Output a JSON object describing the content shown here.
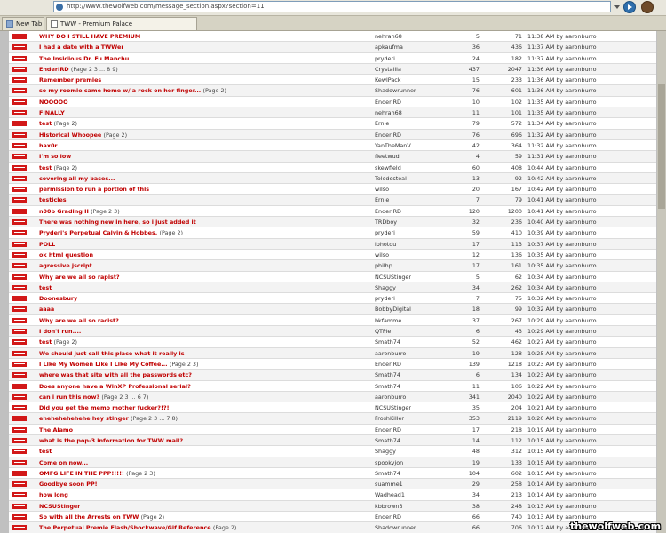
{
  "browser": {
    "url": "http://www.thewolfweb.com/message_section.aspx?section=11",
    "tabs": [
      {
        "label": "New Tab"
      },
      {
        "label": "TWW - Premium Palace"
      }
    ]
  },
  "watermark": "thewolfweb.com",
  "threads": [
    {
      "title": "WHY DO I STILL HAVE PREMIUM",
      "pages": "",
      "author": "nehrah68",
      "replies": "5",
      "views": "71",
      "last": "11:38 AM by aaronburro"
    },
    {
      "title": "I had a date with a TWWer",
      "pages": "",
      "author": "apkaufma",
      "replies": "36",
      "views": "436",
      "last": "11:37 AM by aaronburro"
    },
    {
      "title": "The Insidious Dr. Fu Manchu",
      "pages": "",
      "author": "pryderi",
      "replies": "24",
      "views": "182",
      "last": "11:37 AM by aaronburro"
    },
    {
      "title": "EnderIRD",
      "pages": "(Page 2 3 ... 8 9)",
      "author": "Crystallia",
      "replies": "437",
      "views": "2047",
      "last": "11:36 AM by aaronburro"
    },
    {
      "title": "Remember premies",
      "pages": "",
      "author": "KewlPack",
      "replies": "15",
      "views": "233",
      "last": "11:36 AM by aaronburro"
    },
    {
      "title": "so my roomie came home w/ a rock on her finger...",
      "pages": "(Page 2)",
      "author": "Shadowrunner",
      "replies": "76",
      "views": "601",
      "last": "11:36 AM by aaronburro"
    },
    {
      "title": "NOOOOO",
      "pages": "",
      "author": "EnderIRD",
      "replies": "10",
      "views": "102",
      "last": "11:35 AM by aaronburro"
    },
    {
      "title": "FINALLY",
      "pages": "",
      "author": "nehrah68",
      "replies": "11",
      "views": "101",
      "last": "11:35 AM by aaronburro"
    },
    {
      "title": "test",
      "pages": "(Page 2)",
      "author": "Ernie",
      "replies": "79",
      "views": "572",
      "last": "11:34 AM by aaronburro"
    },
    {
      "title": "Historical Whoopee",
      "pages": "(Page 2)",
      "author": "EnderIRD",
      "replies": "76",
      "views": "696",
      "last": "11:32 AM by aaronburro"
    },
    {
      "title": "hax0r",
      "pages": "",
      "author": "YanTheManV",
      "replies": "42",
      "views": "364",
      "last": "11:32 AM by aaronburro"
    },
    {
      "title": "I'm so low",
      "pages": "",
      "author": "fleetwud",
      "replies": "4",
      "views": "59",
      "last": "11:31 AM by aaronburro"
    },
    {
      "title": "test",
      "pages": "(Page 2)",
      "author": "skewfield",
      "replies": "60",
      "views": "408",
      "last": "10:44 AM by aaronburro"
    },
    {
      "title": "covering all my bases...",
      "pages": "",
      "author": "Toledosteal",
      "replies": "13",
      "views": "92",
      "last": "10:42 AM by aaronburro"
    },
    {
      "title": "permission to run a portion of this",
      "pages": "",
      "author": "wilso",
      "replies": "20",
      "views": "167",
      "last": "10:42 AM by aaronburro"
    },
    {
      "title": "testicles",
      "pages": "",
      "author": "Ernie",
      "replies": "7",
      "views": "79",
      "last": "10:41 AM by aaronburro"
    },
    {
      "title": "n00b Grading II",
      "pages": "(Page 2 3)",
      "author": "EnderIRD",
      "replies": "120",
      "views": "1200",
      "last": "10:41 AM by aaronburro"
    },
    {
      "title": "There was nothing new in here, so i just added it",
      "pages": "",
      "author": "TRDboy",
      "replies": "32",
      "views": "236",
      "last": "10:40 AM by aaronburro"
    },
    {
      "title": "Pryderi's Perpetual Calvin & Hobbes.",
      "pages": "(Page 2)",
      "author": "pryderi",
      "replies": "59",
      "views": "410",
      "last": "10:39 AM by aaronburro"
    },
    {
      "title": "POLL",
      "pages": "",
      "author": "iphotou",
      "replies": "17",
      "views": "113",
      "last": "10:37 AM by aaronburro"
    },
    {
      "title": "ok html question",
      "pages": "",
      "author": "wilso",
      "replies": "12",
      "views": "136",
      "last": "10:35 AM by aaronburro"
    },
    {
      "title": "agressive jscript",
      "pages": "",
      "author": "philhp",
      "replies": "17",
      "views": "161",
      "last": "10:35 AM by aaronburro"
    },
    {
      "title": "Why are we all so rapist?",
      "pages": "",
      "author": "NCSUStinger",
      "replies": "5",
      "views": "62",
      "last": "10:34 AM by aaronburro"
    },
    {
      "title": "test",
      "pages": "",
      "author": "Shaggy",
      "replies": "34",
      "views": "262",
      "last": "10:34 AM by aaronburro"
    },
    {
      "title": "Doonesbury",
      "pages": "",
      "author": "pryderi",
      "replies": "7",
      "views": "75",
      "last": "10:32 AM by aaronburro"
    },
    {
      "title": "aaaa",
      "pages": "",
      "author": "BobbyDigital",
      "replies": "18",
      "views": "99",
      "last": "10:32 AM by aaronburro"
    },
    {
      "title": "Why are we all so racist?",
      "pages": "",
      "author": "bkfamme",
      "replies": "37",
      "views": "267",
      "last": "10:29 AM by aaronburro"
    },
    {
      "title": "I don't run....",
      "pages": "",
      "author": "QTPie",
      "replies": "6",
      "views": "43",
      "last": "10:29 AM by aaronburro"
    },
    {
      "title": "test",
      "pages": "(Page 2)",
      "author": "Smath74",
      "replies": "52",
      "views": "462",
      "last": "10:27 AM by aaronburro"
    },
    {
      "title": "We should just call this place what it really is",
      "pages": "",
      "author": "aaronburro",
      "replies": "19",
      "views": "128",
      "last": "10:25 AM by aaronburro"
    },
    {
      "title": "I Like My Women Like I Like My Coffee...",
      "pages": "(Page 2 3)",
      "author": "EnderIRD",
      "replies": "139",
      "views": "1218",
      "last": "10:23 AM by aaronburro"
    },
    {
      "title": "where was that site with all the passwords etc?",
      "pages": "",
      "author": "Smath74",
      "replies": "6",
      "views": "134",
      "last": "10:23 AM by aaronburro"
    },
    {
      "title": "Does anyone have a WinXP Professional serial?",
      "pages": "",
      "author": "Smath74",
      "replies": "11",
      "views": "106",
      "last": "10:22 AM by aaronburro"
    },
    {
      "title": "can i run this now?",
      "pages": "(Page 2 3 ... 6 7)",
      "author": "aaronburro",
      "replies": "341",
      "views": "2040",
      "last": "10:22 AM by aaronburro"
    },
    {
      "title": "Did you get the memo mother fucker?!?!",
      "pages": "",
      "author": "NCSUStinger",
      "replies": "35",
      "views": "204",
      "last": "10:21 AM by aaronburro"
    },
    {
      "title": "ehehehehehehe hey stinger",
      "pages": "(Page 2 3 ... 7 8)",
      "author": "FroshKiller",
      "replies": "353",
      "views": "2119",
      "last": "10:20 AM by aaronburro"
    },
    {
      "title": "The Alamo",
      "pages": "",
      "author": "EnderIRD",
      "replies": "17",
      "views": "218",
      "last": "10:19 AM by aaronburro"
    },
    {
      "title": "what is the pop-3 information for TWW mail?",
      "pages": "",
      "author": "Smath74",
      "replies": "14",
      "views": "112",
      "last": "10:15 AM by aaronburro"
    },
    {
      "title": "test",
      "pages": "",
      "author": "Shaggy",
      "replies": "48",
      "views": "312",
      "last": "10:15 AM by aaronburro"
    },
    {
      "title": "Come on now...",
      "pages": "",
      "author": "spookyjon",
      "replies": "19",
      "views": "133",
      "last": "10:15 AM by aaronburro"
    },
    {
      "title": "OMFG LIFE IN THE PPP!!!!!",
      "pages": "(Page 2 3)",
      "author": "Smath74",
      "replies": "104",
      "views": "602",
      "last": "10:15 AM by aaronburro"
    },
    {
      "title": "Goodbye soon PP!",
      "pages": "",
      "author": "suamme1",
      "replies": "29",
      "views": "258",
      "last": "10:14 AM by aaronburro"
    },
    {
      "title": "how long",
      "pages": "",
      "author": "Wadhead1",
      "replies": "34",
      "views": "213",
      "last": "10:14 AM by aaronburro"
    },
    {
      "title": "NCSUStinger",
      "pages": "",
      "author": "kbbrown3",
      "replies": "38",
      "views": "248",
      "last": "10:13 AM by aaronburro"
    },
    {
      "title": "So with all the Arrests on TWW",
      "pages": "(Page 2)",
      "author": "EnderIRD",
      "replies": "66",
      "views": "740",
      "last": "10:13 AM by aaronburro"
    },
    {
      "title": "The Perpetual Premie Flash/Shockwave/Gif Reference",
      "pages": "(Page 2)",
      "author": "Shadowrunner",
      "replies": "66",
      "views": "706",
      "last": "10:12 AM by aaronburro"
    }
  ]
}
